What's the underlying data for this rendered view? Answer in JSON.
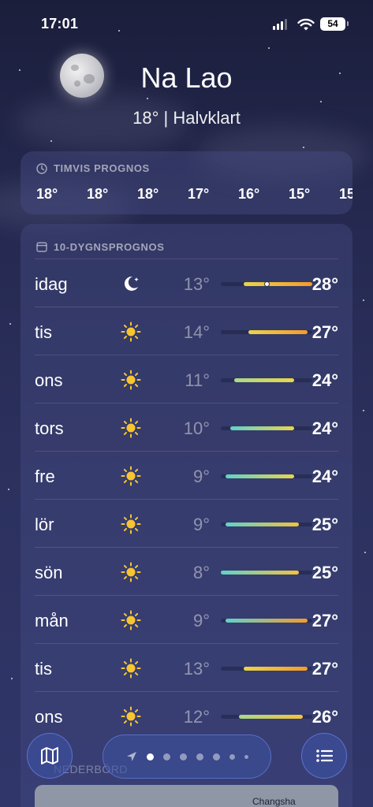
{
  "status_bar": {
    "time": "17:01",
    "battery": "54"
  },
  "header": {
    "city": "Na Lao",
    "subline": "18°  |  Halvklart"
  },
  "hourly": {
    "title": "TIMVIS PROGNOS",
    "temps": [
      "18°",
      "18°",
      "18°",
      "17°",
      "16°",
      "15°",
      "15"
    ]
  },
  "daily": {
    "title": "10-DYGNSPROGNOS",
    "range_min": 8,
    "range_max": 28,
    "rows": [
      {
        "day": "idag",
        "icon": "moon-icon",
        "lo": "13°",
        "hi": "28°",
        "lo_v": 13,
        "hi_v": 28,
        "current": 18
      },
      {
        "day": "tis",
        "icon": "sun-icon",
        "lo": "14°",
        "hi": "27°",
        "lo_v": 14,
        "hi_v": 27
      },
      {
        "day": "ons",
        "icon": "sun-icon",
        "lo": "11°",
        "hi": "24°",
        "lo_v": 11,
        "hi_v": 24
      },
      {
        "day": "tors",
        "icon": "sun-icon",
        "lo": "10°",
        "hi": "24°",
        "lo_v": 10,
        "hi_v": 24
      },
      {
        "day": "fre",
        "icon": "sun-icon",
        "lo": "9°",
        "hi": "24°",
        "lo_v": 9,
        "hi_v": 24
      },
      {
        "day": "lör",
        "icon": "sun-icon",
        "lo": "9°",
        "hi": "25°",
        "lo_v": 9,
        "hi_v": 25
      },
      {
        "day": "sön",
        "icon": "sun-icon",
        "lo": "8°",
        "hi": "25°",
        "lo_v": 8,
        "hi_v": 25
      },
      {
        "day": "mån",
        "icon": "sun-icon",
        "lo": "9°",
        "hi": "27°",
        "lo_v": 9,
        "hi_v": 27
      },
      {
        "day": "tis",
        "icon": "sun-icon",
        "lo": "13°",
        "hi": "27°",
        "lo_v": 13,
        "hi_v": 27
      },
      {
        "day": "ons",
        "icon": "sun-icon",
        "lo": "12°",
        "hi": "26°",
        "lo_v": 12,
        "hi_v": 26
      }
    ]
  },
  "bottom": {
    "ghost_label": "NEDERBÖRD",
    "map_label": "Changsha",
    "page_count": 7,
    "active_page": 1
  },
  "colors": {
    "cool": "#5fd3c9",
    "mid": "#e9d54a",
    "warm": "#f59a2a"
  }
}
